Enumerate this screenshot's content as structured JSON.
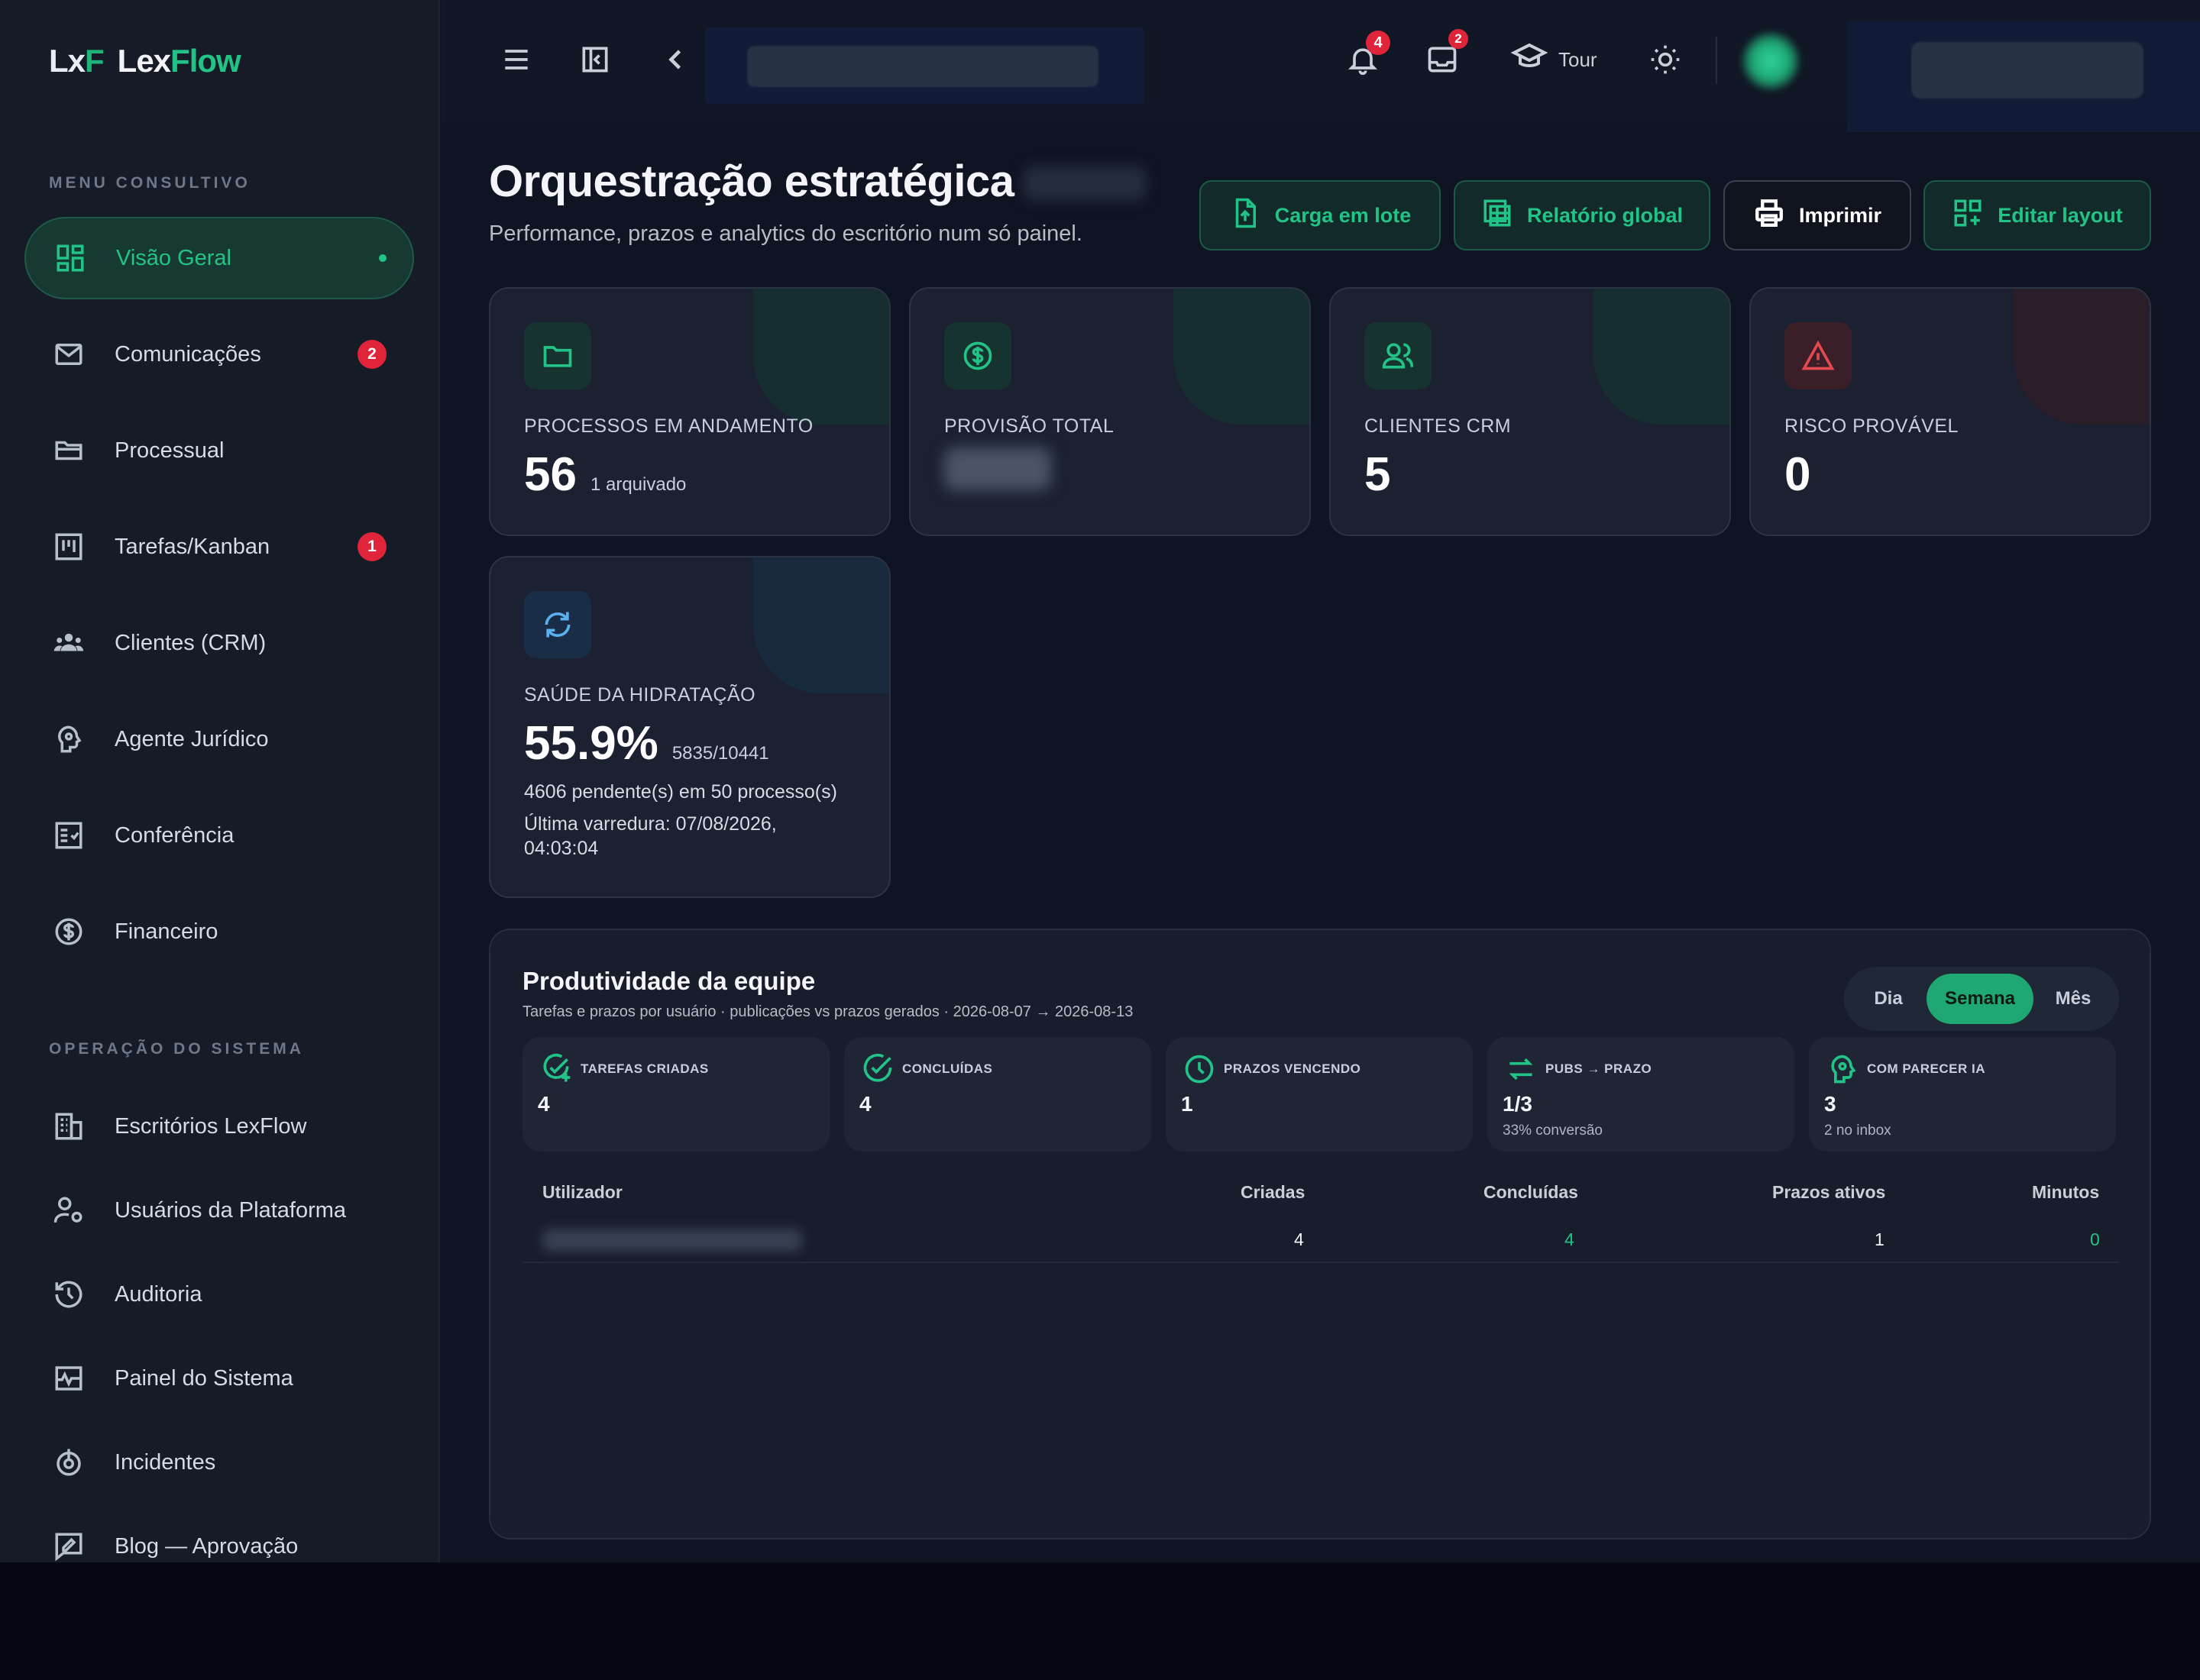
{
  "brand": {
    "mark_left": "Lx",
    "mark_right": "F",
    "name_left": "Lex",
    "name_right": "Flow"
  },
  "sidebar": {
    "section1": "MENU CONSULTIVO",
    "section2": "OPERAÇÃO DO SISTEMA",
    "items1": [
      {
        "label": "Visão Geral",
        "icon": "dashboard-icon",
        "active": true
      },
      {
        "label": "Comunicações",
        "icon": "mail-icon",
        "badge": "2"
      },
      {
        "label": "Processual",
        "icon": "folder-open-icon"
      },
      {
        "label": "Tarefas/Kanban",
        "icon": "kanban-icon",
        "badge": "1"
      },
      {
        "label": "Clientes (CRM)",
        "icon": "users-icon"
      },
      {
        "label": "Agente Jurídico",
        "icon": "brain-gear-icon"
      },
      {
        "label": "Conferência",
        "icon": "checklist-icon"
      },
      {
        "label": "Financeiro",
        "icon": "dollar-circle-icon"
      }
    ],
    "items2": [
      {
        "label": "Escritórios LexFlow",
        "icon": "building-icon"
      },
      {
        "label": "Usuários da Plataforma",
        "icon": "user-cog-icon"
      },
      {
        "label": "Auditoria",
        "icon": "history-icon"
      },
      {
        "label": "Painel do Sistema",
        "icon": "activity-icon"
      },
      {
        "label": "Incidentes",
        "icon": "radar-icon"
      },
      {
        "label": "Blog — Aprovação",
        "icon": "blog-edit-icon"
      }
    ]
  },
  "topbar": {
    "notifications_count": "4",
    "inbox_count": "2",
    "tour_label": "Tour",
    "search_placeholder": ""
  },
  "header": {
    "title": "Orquestração estratégica",
    "subtitle": "Performance, prazos e analytics do escritório num só painel.",
    "buttons": {
      "bulk": "Carga em lote",
      "report": "Relatório global",
      "print": "Imprimir",
      "layout": "Editar layout"
    }
  },
  "kpis": {
    "processes": {
      "title": "PROCESSOS EM ANDAMENTO",
      "value": "56",
      "sub": "1 arquivado"
    },
    "provision": {
      "title": "PROVISÃO TOTAL"
    },
    "clients": {
      "title": "CLIENTES CRM",
      "value": "5"
    },
    "risk": {
      "title": "RISCO PROVÁVEL",
      "value": "0"
    },
    "hydration": {
      "title": "SAÚDE DA HIDRATAÇÃO",
      "value": "55.9%",
      "sub": "5835/10441",
      "line1": "4606 pendente(s) em 50 processo(s)",
      "line2": "Última varredura: 07/08/2026,",
      "line3": "04:03:04"
    }
  },
  "productivity": {
    "title": "Produtividade da equipe",
    "subtitle": "Tarefas e prazos por usuário · publicações vs prazos gerados · 2026-08-07 → 2026-08-13",
    "periods": [
      "Dia",
      "Semana",
      "Mês"
    ],
    "active_period": "Semana",
    "stats": [
      {
        "label": "TAREFAS CRIADAS",
        "value": "4",
        "icon": "task-add-icon"
      },
      {
        "label": "CONCLUÍDAS",
        "value": "4",
        "icon": "check-circle-icon"
      },
      {
        "label": "PRAZOS VENCENDO",
        "value": "1",
        "icon": "clock-icon"
      },
      {
        "label": "PUBS → PRAZO",
        "value": "1/3",
        "note": "33% conversão",
        "icon": "swap-icon"
      },
      {
        "label": "COM PARECER IA",
        "value": "3",
        "note": "2 no inbox",
        "icon": "ai-brain-icon"
      }
    ],
    "table": {
      "headers": [
        "Utilizador",
        "Criadas",
        "Concluídas",
        "Prazos ativos",
        "Minutos"
      ],
      "rows": [
        {
          "criadas": "4",
          "concluidas": "4",
          "prazos": "1",
          "minutos": "0"
        }
      ]
    }
  },
  "colors": {
    "accent": "#22c386",
    "danger": "#e0253a",
    "background": "#0f1422",
    "sidebar": "#151b27",
    "card": "#1b2131"
  }
}
